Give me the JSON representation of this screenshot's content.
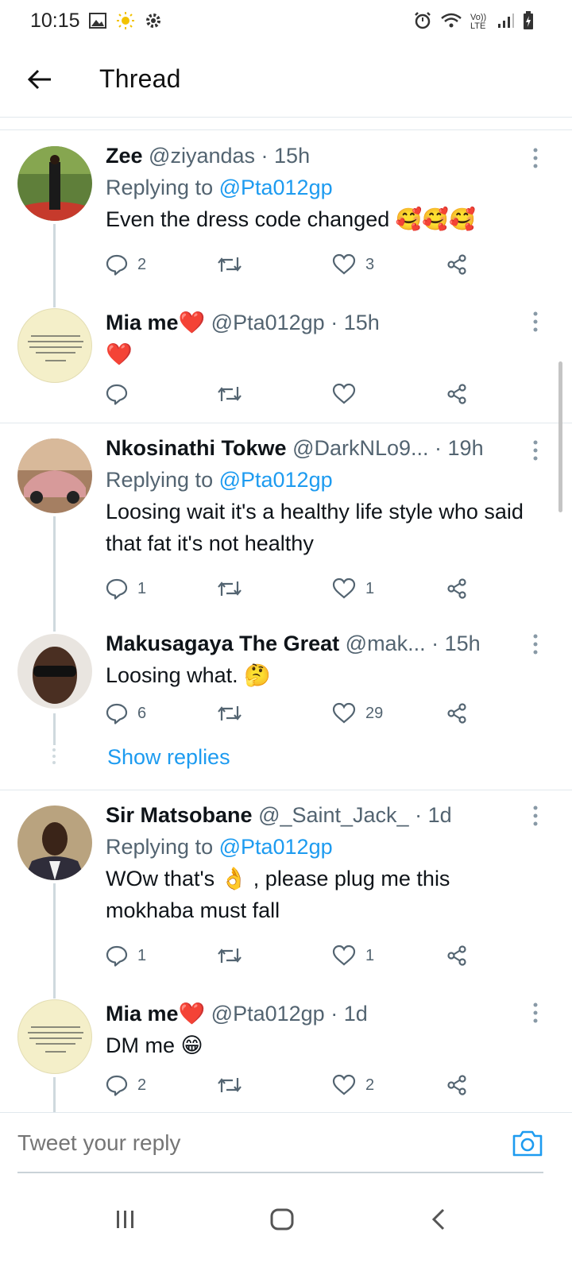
{
  "status_bar": {
    "time": "10:15",
    "left_icons": [
      "gallery-icon",
      "sun-icon",
      "gear-icon"
    ],
    "right_icons": [
      "alarm-icon",
      "wifi-icon",
      "volte-icon",
      "signal-icon",
      "battery-icon"
    ],
    "volte_label": "Vo)) LTE"
  },
  "header": {
    "back_icon": "arrow-left-icon",
    "title": "Thread"
  },
  "tweets": [
    {
      "name": "Zee",
      "handle": "@ziyandas",
      "time": "· 15h",
      "replying_prefix": "Replying to ",
      "replying_to": "@Pta012gp",
      "text": "Even the dress code changed 🥰🥰🥰",
      "replies": "2",
      "retweets": "",
      "likes": "3"
    },
    {
      "name": "Mia me❤️",
      "handle": "@Pta012gp",
      "time": "· 15h",
      "text": "❤️",
      "replies": "",
      "retweets": "",
      "likes": ""
    },
    {
      "name": "Nkosinathi Tokwe",
      "handle": "@DarkNLo9...",
      "time": "· 19h",
      "replying_prefix": "Replying to ",
      "replying_to": "@Pta012gp",
      "text": "Loosing wait it's a healthy life style who said that fat it's not healthy",
      "replies": "1",
      "retweets": "",
      "likes": "1"
    },
    {
      "name": "Makusagaya The Great",
      "handle": "@mak...",
      "time": "· 15h",
      "text": "Loosing what. 🤔",
      "replies": "6",
      "retweets": "",
      "likes": "29"
    },
    {
      "name": "Sir Matsobane",
      "handle": "@_Saint_Jack_",
      "time": "· 1d",
      "replying_prefix": "Replying to ",
      "replying_to": "@Pta012gp",
      "text": "WOw that's 👌 , please plug me this mokhaba must fall",
      "replies": "1",
      "retweets": "",
      "likes": "1"
    },
    {
      "name": "Mia me❤️",
      "handle": "@Pta012gp",
      "time": "· 1d",
      "text": "DM me 😁",
      "replies": "2",
      "retweets": "",
      "likes": "2"
    }
  ],
  "show_replies": "Show replies",
  "reply_box": {
    "placeholder": "Tweet your reply",
    "camera_icon": "camera-icon"
  },
  "nav_bar": {
    "icons": [
      "recent-apps-icon",
      "home-icon",
      "back-icon"
    ]
  },
  "colors": {
    "accent": "#1d9bf0",
    "secondary_text": "#536471",
    "divider": "#e1e8ed",
    "thread_line": "#cfd9de"
  }
}
